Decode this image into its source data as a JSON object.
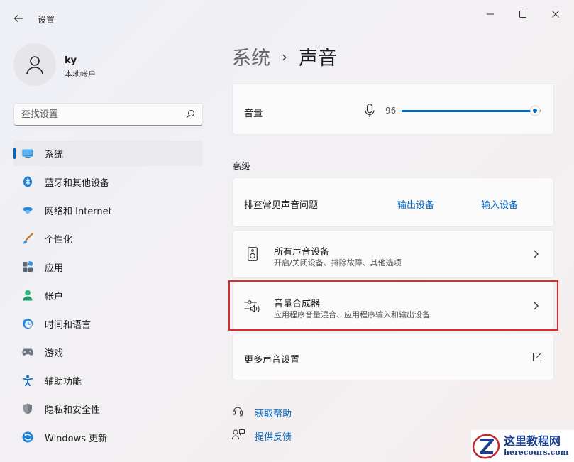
{
  "window": {
    "title": "设置",
    "controls": [
      "minimize",
      "maximize",
      "close"
    ]
  },
  "user": {
    "name": "ky",
    "account_type": "本地帐户"
  },
  "search": {
    "placeholder": "查找设置"
  },
  "sidebar": {
    "items": [
      {
        "label": "系统",
        "icon": "system-icon",
        "active": true
      },
      {
        "label": "蓝牙和其他设备",
        "icon": "bluetooth-icon"
      },
      {
        "label": "网络和 Internet",
        "icon": "wifi-icon"
      },
      {
        "label": "个性化",
        "icon": "brush-icon"
      },
      {
        "label": "应用",
        "icon": "apps-icon"
      },
      {
        "label": "帐户",
        "icon": "account-icon"
      },
      {
        "label": "时间和语言",
        "icon": "clock-globe-icon"
      },
      {
        "label": "游戏",
        "icon": "gamepad-icon"
      },
      {
        "label": "辅助功能",
        "icon": "accessibility-icon"
      },
      {
        "label": "隐私和安全性",
        "icon": "shield-icon"
      },
      {
        "label": "Windows 更新",
        "icon": "update-icon"
      }
    ]
  },
  "breadcrumb": {
    "parent": "系统",
    "separator": "›",
    "current": "声音"
  },
  "volume": {
    "label": "音量",
    "value_text": "96",
    "value": 96,
    "icon": "microphone-icon"
  },
  "advanced": {
    "heading": "高级",
    "troubleshoot": {
      "label": "排查常见声音问题",
      "output_link": "输出设备",
      "input_link": "输入设备"
    },
    "all_devices": {
      "title": "所有声音设备",
      "subtitle": "开启/关闭设备、排除故障、其他选项",
      "icon": "speaker-icon"
    },
    "mixer": {
      "title": "音量合成器",
      "subtitle": "应用程序音量混合、应用程序输入和输出设备",
      "icon": "volume-mixer-icon"
    },
    "more": {
      "title": "更多声音设置",
      "icon": "external-link-icon"
    }
  },
  "help": {
    "get_help": "获取帮助",
    "feedback": "提供反馈"
  },
  "watermark": {
    "title": "这里教程网",
    "url": "herecours.com"
  },
  "colors": {
    "accent": "#0067c0",
    "highlight_border": "#e0292a"
  }
}
